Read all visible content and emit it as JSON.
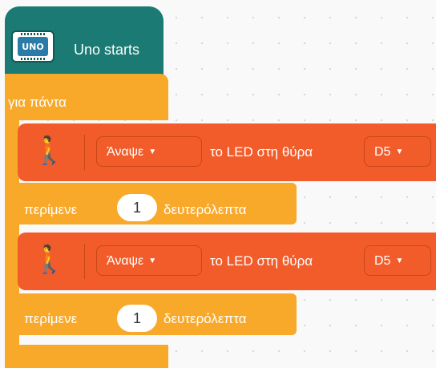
{
  "hat": {
    "label": "Uno starts",
    "icon_text": "UNO",
    "color": "#1b7a73"
  },
  "forever": {
    "label": "για πάντα",
    "color": "#f8a92a"
  },
  "led_blocks": [
    {
      "action": "Άναψε",
      "text": "το LED στη θύρα",
      "port": "D5",
      "icon": "led-people-icon"
    },
    {
      "action": "Άναψε",
      "text": "το LED στη θύρα",
      "port": "D5",
      "icon": "led-people-icon"
    }
  ],
  "wait_blocks": [
    {
      "prefix": "περίμενε",
      "value": "1",
      "suffix": "δευτερόλεπτα"
    },
    {
      "prefix": "περίμενε",
      "value": "1",
      "suffix": "δευτερόλεπτα"
    }
  ],
  "colors": {
    "led_block": "#f25c2a",
    "canvas": "#f9f9f9"
  }
}
